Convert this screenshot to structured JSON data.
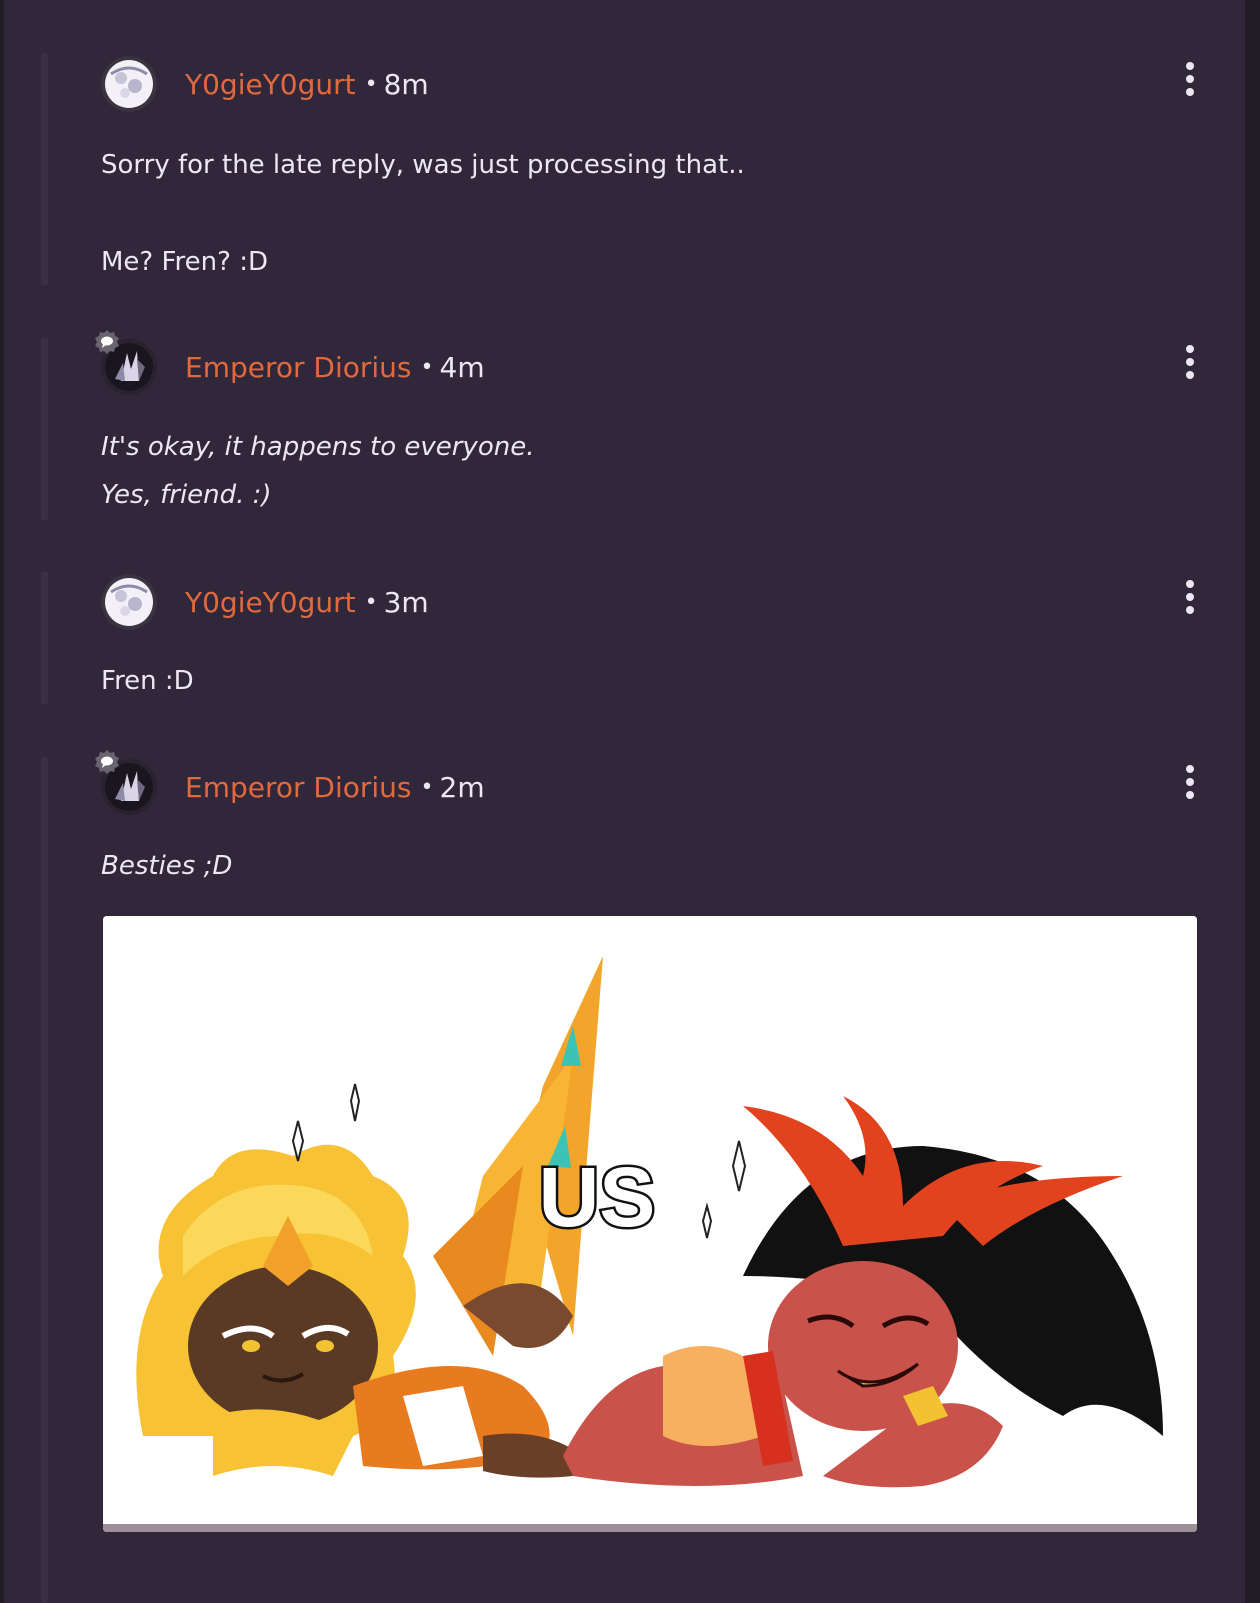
{
  "comments": [
    {
      "username": "Y0gieY0gurt",
      "time": "8m",
      "lines": [
        "Sorry for the late reply, was just processing that..",
        "Me? Fren? :D"
      ]
    },
    {
      "username": "Emperor Diorius",
      "time": "4m",
      "lines": [
        "It's okay, it happens to everyone.",
        "Yes, friend. :)"
      ]
    },
    {
      "username": "Y0gieY0gurt",
      "time": "3m",
      "lines": [
        "Fren :D"
      ]
    },
    {
      "username": "Emperor Diorius",
      "time": "2m",
      "lines": [
        "Besties ;D"
      ],
      "image_caption": "US"
    }
  ],
  "colors": {
    "background": "#31273a",
    "username": "#e06a3d",
    "text": "#ece7f2"
  },
  "icons": {
    "menu": "more-vertical-icon",
    "badge": "chat-bubble-badge-icon"
  }
}
